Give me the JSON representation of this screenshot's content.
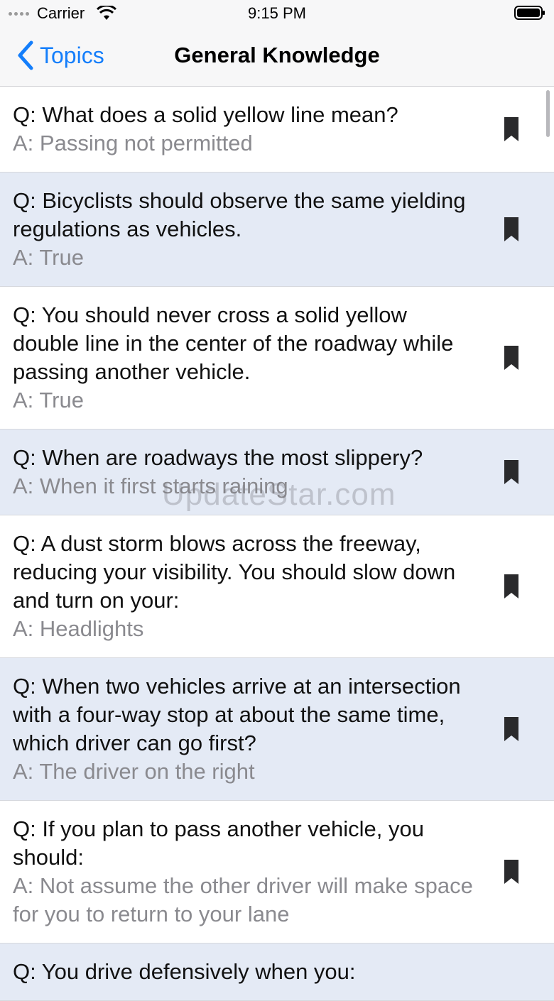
{
  "status_bar": {
    "carrier": "Carrier",
    "time": "9:15 PM"
  },
  "nav": {
    "back_label": "Topics",
    "title": "General Knowledge"
  },
  "accent_color": "#147efb",
  "row_shade_color": "#e4eaf5",
  "watermark": "UpdateStar.com",
  "items": [
    {
      "q": "Q: What does a solid yellow line mean?",
      "a": "A: Passing not permitted"
    },
    {
      "q": "Q: Bicyclists should observe the same yielding regulations as vehicles.",
      "a": "A: True"
    },
    {
      "q": "Q: You should never cross a solid yellow double line in the center of the roadway while passing another vehicle.",
      "a": "A: True"
    },
    {
      "q": "Q: When are roadways the most slippery?",
      "a": "A: When it first starts raining"
    },
    {
      "q": "Q: A dust storm blows across the freeway, reducing your visibility. You should slow down and turn on your:",
      "a": "A: Headlights"
    },
    {
      "q": "Q: When two vehicles arrive at an intersection with a four-way stop at about the same time, which driver can go first?",
      "a": "A: The driver on the right"
    },
    {
      "q": "Q: If you plan to pass another vehicle, you should:",
      "a": "A: Not assume the other driver will make space for you to return to your lane"
    },
    {
      "q": "Q: You drive defensively when you:",
      "a": ""
    }
  ]
}
